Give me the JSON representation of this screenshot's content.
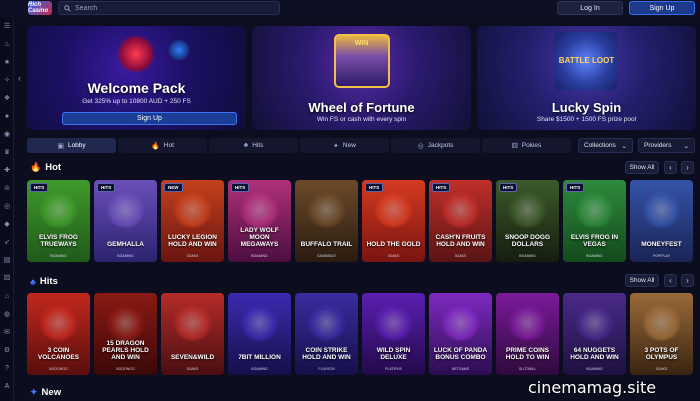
{
  "header": {
    "logo_text": "Rich Casino",
    "search_placeholder": "Search",
    "login_label": "Log In",
    "signup_label": "Sign Up"
  },
  "sidebar": {
    "icons": [
      "menu-icon",
      "flame-icon",
      "star-icon",
      "sparkle-icon",
      "slot-icon",
      "cards-icon",
      "live-icon",
      "trophy-icon",
      "gift-icon",
      "crown-icon",
      "chip-icon",
      "diamond-icon",
      "rocket-icon",
      "chart-icon",
      "dice-icon",
      "tag-icon",
      "globe-icon",
      "chat-icon",
      "gear-icon",
      "help-icon",
      "lang-icon"
    ]
  },
  "banners": [
    {
      "title": "Welcome Pack",
      "subtitle": "Get 325% up to 10800 AUD + 250 FS",
      "button": "Sign Up"
    },
    {
      "title": "Wheel of Fortune",
      "subtitle": "Win FS or cash with every spin",
      "tag": "WIN"
    },
    {
      "title": "Lucky Spin",
      "subtitle": "Share $1500 + 1500 FS prize pool",
      "tag": "BATTLE LOOT"
    }
  ],
  "tabs": [
    {
      "label": "Lobby",
      "icon": "lobby-icon",
      "active": true
    },
    {
      "label": "Hot",
      "icon": "flame-icon",
      "active": false
    },
    {
      "label": "Hits",
      "icon": "hits-icon",
      "active": false
    },
    {
      "label": "New",
      "icon": "new-icon",
      "active": false
    },
    {
      "label": "Jackpots",
      "icon": "jackpot-icon",
      "active": false
    },
    {
      "label": "Pokies",
      "icon": "pokies-icon",
      "active": false
    }
  ],
  "filters": {
    "collections": "Collections",
    "providers": "Providers"
  },
  "sections": {
    "hot": {
      "title": "Hot",
      "show_all": "Show All",
      "games": [
        {
          "name": "ELVIS FROG TRUEWAYS",
          "badge": "HITS",
          "provider": "BGAMING",
          "color1": "#3f9a2a",
          "color2": "#1f5a1a"
        },
        {
          "name": "GEMHALLA",
          "badge": "HITS",
          "provider": "BGAMING",
          "color1": "#6a4fb8",
          "color2": "#2c2370"
        },
        {
          "name": "LUCKY LEGION HOLD AND WIN",
          "badge": "NEW",
          "provider": "3OAKS",
          "color1": "#c4411c",
          "color2": "#6a1410"
        },
        {
          "name": "LADY WOLF MOON MEGAWAYS",
          "badge": "HITS",
          "provider": "BGAMING",
          "color1": "#b0307a",
          "color2": "#4c0e40"
        },
        {
          "name": "BUFFALO TRAIL",
          "badge": "",
          "provider": "GAMEBEAT",
          "color1": "#6b4a2a",
          "color2": "#2a1b10"
        },
        {
          "name": "HOLD THE GOLD",
          "badge": "HITS",
          "provider": "3OAKS",
          "color1": "#d43a20",
          "color2": "#7a1410"
        },
        {
          "name": "CASH'N FRUITS HOLD AND WIN",
          "badge": "HITS",
          "provider": "3OAKS",
          "color1": "#c02f2a",
          "color2": "#5a1414"
        },
        {
          "name": "SNOOP DOGG DOLLARS",
          "badge": "HITS",
          "provider": "BGAMING",
          "color1": "#3c5a2a",
          "color2": "#151d10"
        },
        {
          "name": "ELVIS FROG IN VEGAS",
          "badge": "HITS",
          "provider": "BGAMING",
          "color1": "#2e8a3c",
          "color2": "#134a1c"
        },
        {
          "name": "MONEYFEST",
          "badge": "",
          "provider": "POPIPLAY",
          "color1": "#3553a8",
          "color2": "#1a2455"
        }
      ]
    },
    "hits": {
      "title": "Hits",
      "show_all": "Show All",
      "games": [
        {
          "name": "3 COIN VOLCANOES",
          "provider": "BOOONGO",
          "color1": "#c2281e",
          "color2": "#5a0e0c"
        },
        {
          "name": "15 DRAGON PEARLS HOLD AND WIN",
          "provider": "BOOONGO",
          "color1": "#8a1a14",
          "color2": "#3a0808"
        },
        {
          "name": "SEVEN&WILD",
          "provider": "3OAKS",
          "color1": "#b52c28",
          "color2": "#4a0e12"
        },
        {
          "name": "7BIT MILLION",
          "provider": "BGAMING",
          "color1": "#3b2ab0",
          "color2": "#160f4a"
        },
        {
          "name": "COIN STRIKE HOLD AND WIN",
          "provider": "PLAYSON",
          "color1": "#3a2ca0",
          "color2": "#15104a"
        },
        {
          "name": "WILD SPIN DELUXE",
          "provider": "PLATIPUS",
          "color1": "#5a1fb0",
          "color2": "#22094a"
        },
        {
          "name": "LUCK OF PANDA BONUS COMBO",
          "provider": "NETGAME",
          "color1": "#7e2ac0",
          "color2": "#2c0d52"
        },
        {
          "name": "PRIME COINS HOLD TO WIN",
          "provider": "SLOTMILL",
          "color1": "#7a1a9a",
          "color2": "#2e0a3c"
        },
        {
          "name": "64 NUGGETS HOLD AND WIN",
          "provider": "BGAMING",
          "color1": "#4a2a8a",
          "color2": "#1d1040"
        },
        {
          "name": "3 POTS OF OLYMPUS",
          "provider": "3OAKS",
          "color1": "#9a6a3a",
          "color2": "#3a2410"
        }
      ]
    },
    "new": {
      "title": "New"
    }
  },
  "watermark": "cinemamag.site"
}
